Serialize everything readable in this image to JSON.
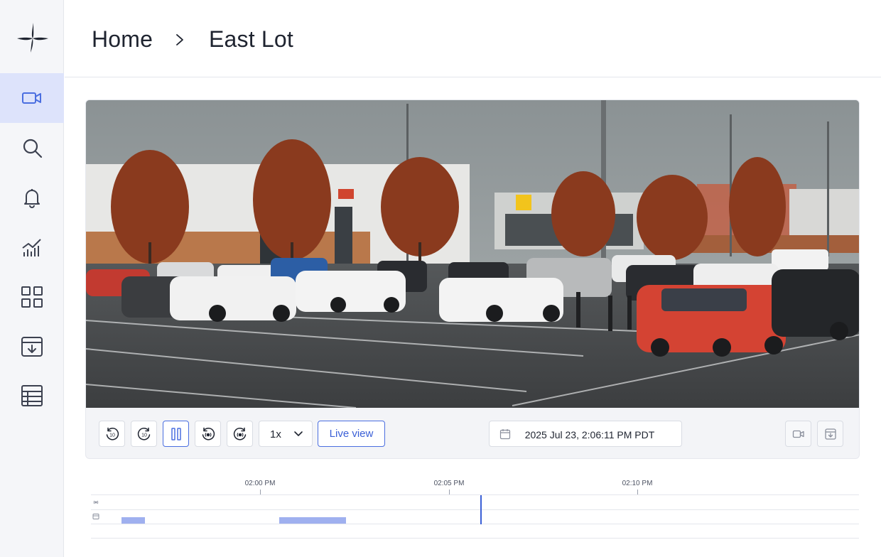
{
  "sidebar": {
    "logo": "sparkle-logo",
    "items": [
      {
        "icon": "video-camera-icon",
        "active": true
      },
      {
        "icon": "search-icon",
        "active": false
      },
      {
        "icon": "bell-icon",
        "active": false
      },
      {
        "icon": "analytics-chart-icon",
        "active": false
      },
      {
        "icon": "grid-icon",
        "active": false
      },
      {
        "icon": "archive-download-icon",
        "active": false
      },
      {
        "icon": "table-icon",
        "active": false
      }
    ]
  },
  "breadcrumb": {
    "home": "Home",
    "separator_icon": "chevron-right-icon",
    "current": "East Lot"
  },
  "player": {
    "controls": {
      "rewind_10_label": "10",
      "forward_10_label": "10",
      "speed": "1x",
      "live_view": "Live view",
      "datetime": "2025 Jul 23, 2:06:11 PM PDT"
    }
  },
  "timeline": {
    "ticks": [
      "02:00 PM",
      "02:05 PM",
      "02:10 PM"
    ]
  },
  "colors": {
    "accent": "#4a6ee0",
    "active_nav_bg": "#dde3fb",
    "segment": "#9fb0ef"
  }
}
